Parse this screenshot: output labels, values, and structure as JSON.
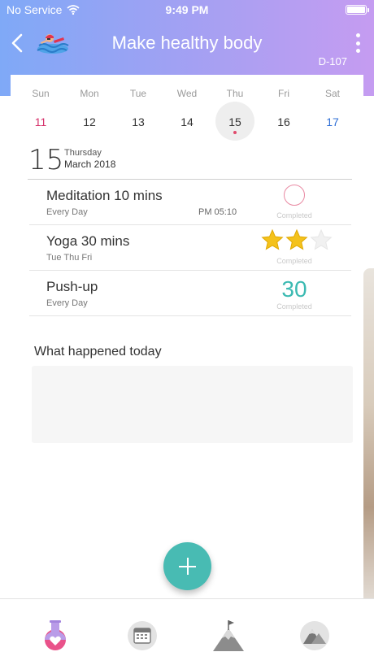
{
  "status_bar": {
    "carrier": "No Service",
    "time": "9:49 PM",
    "wifi_icon": "wifi-icon",
    "battery_level": 1.0
  },
  "header": {
    "title": "Make healthy body",
    "d_day": "D-107",
    "back_icon": "chevron-left-icon",
    "goal_icon": "swimmer-icon",
    "menu_icon": "more-vertical-icon",
    "gradient_start": "#7fa9f7",
    "gradient_end": "#c59cf1"
  },
  "week": {
    "days": [
      {
        "name": "Sun",
        "num": "11",
        "color": "#d6336c"
      },
      {
        "name": "Mon",
        "num": "12",
        "color": "#333333"
      },
      {
        "name": "Tue",
        "num": "13",
        "color": "#333333"
      },
      {
        "name": "Wed",
        "num": "14",
        "color": "#333333"
      },
      {
        "name": "Thu",
        "num": "15",
        "color": "#333333",
        "selected": true
      },
      {
        "name": "Fri",
        "num": "16",
        "color": "#333333"
      },
      {
        "name": "Sat",
        "num": "17",
        "color": "#2f6fd6"
      }
    ]
  },
  "date_header": {
    "day": "15",
    "weekday": "Thursday",
    "month_year": "March 2018"
  },
  "habits": [
    {
      "name": "Meditation 10 mins",
      "schedule": "Every Day",
      "time": "PM 05:10",
      "status_type": "ring",
      "status_label": "Completed"
    },
    {
      "name": "Yoga 30 mins",
      "schedule": "Tue Thu Fri",
      "time": "",
      "status_type": "stars",
      "stars_filled": 2,
      "stars_total": 3,
      "status_label": "Completed"
    },
    {
      "name": "Push-up",
      "schedule": "Every Day",
      "time": "",
      "status_type": "count",
      "count": "30",
      "status_label": "Completed"
    }
  ],
  "notes": {
    "title": "What happened today",
    "placeholder": ""
  },
  "fab": {
    "icon": "plus-icon",
    "color": "#48bbb3"
  },
  "tabbar": {
    "tabs": [
      {
        "icon": "potion-heart-icon"
      },
      {
        "icon": "calendar-icon"
      },
      {
        "icon": "mountain-flag-icon"
      },
      {
        "icon": "mountain-circle-icon"
      }
    ]
  }
}
